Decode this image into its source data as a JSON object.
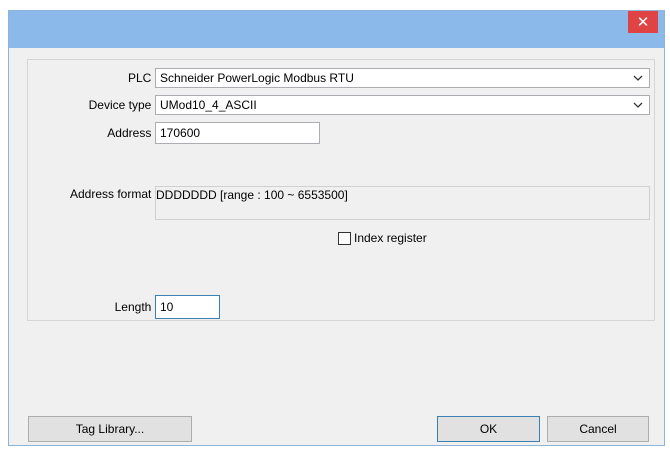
{
  "titlebar": {
    "close_glyph": "✕"
  },
  "form": {
    "plc_label": "PLC :",
    "plc_value": "Schneider PowerLogic Modbus RTU",
    "device_type_label": "Device type :",
    "device_type_value": "UMod10_4_ASCII",
    "address_label": "Address :",
    "address_value": "170600",
    "address_format_label": "Address format :",
    "address_format_value": "DDDDDDD [range : 100 ~ 6553500]",
    "index_register_label": "Index register",
    "index_register_checked": false,
    "length_label": "Length :",
    "length_value": "10"
  },
  "buttons": {
    "tag_library": "Tag Library...",
    "ok": "OK",
    "cancel": "Cancel"
  },
  "icons": {
    "dropdown": "chevron-down-icon",
    "close": "close-icon"
  }
}
